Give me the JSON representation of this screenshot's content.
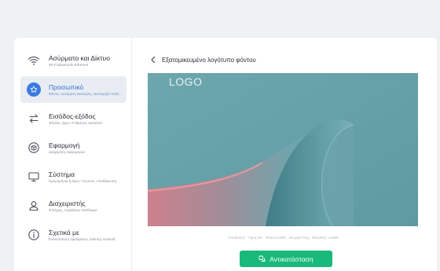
{
  "sidebar": {
    "items": [
      {
        "key": "network",
        "icon": "wifi-icon",
        "label": "Ασύρματο και Δίκτυο",
        "sub": "Wi-Fi,Bluetooth,Ethernet"
      },
      {
        "key": "personal",
        "icon": "star-icon",
        "label": "Προσωπικό",
        "sub": "Φόντο, Αυτόματη εκκίνηση, Λειτουργία πολλαπλών παραθύρων",
        "active": true
      },
      {
        "key": "io",
        "icon": "swap-arrows-icon",
        "label": "Εισόδος-εξόδος",
        "sub": "Έξοδος ήχου, Ρυθμίσεις καναλιού"
      },
      {
        "key": "apps",
        "icon": "cube-icon",
        "label": "Εφαρμογή",
        "sub": "Διαχείριση εφαρμογών"
      },
      {
        "key": "system",
        "icon": "monitor-icon",
        "label": "Σύστημα",
        "sub": "Ημερομηνία & Ώρα, Γλώσσα, Αποθήκευση"
      },
      {
        "key": "admin",
        "icon": "user-icon",
        "label": "Διαχειριστής",
        "sub": "Έλεγχος, Ασφάλεια, Κλείδωμα"
      },
      {
        "key": "about",
        "icon": "info-icon",
        "label": "Σχετικά με",
        "sub": "Κοινοποίηση σφάλματος, έκδοση Android"
      }
    ]
  },
  "main": {
    "title": "Εξατομικευμένο λογότυπο φόντου",
    "preview": {
      "logo_text": "LOGO"
    },
    "meta": "Υποδείξεις: Ύψος:60 , Μήκος:1800 , Μορφή:Png , Μέγεθος: ≤1MB",
    "replace_label": "Αντικατάσταση"
  },
  "colors": {
    "accent": "#3a7be0",
    "button": "#18b97a",
    "preview_base": "#6aa4ab",
    "preview_curve": "#e0807e"
  }
}
